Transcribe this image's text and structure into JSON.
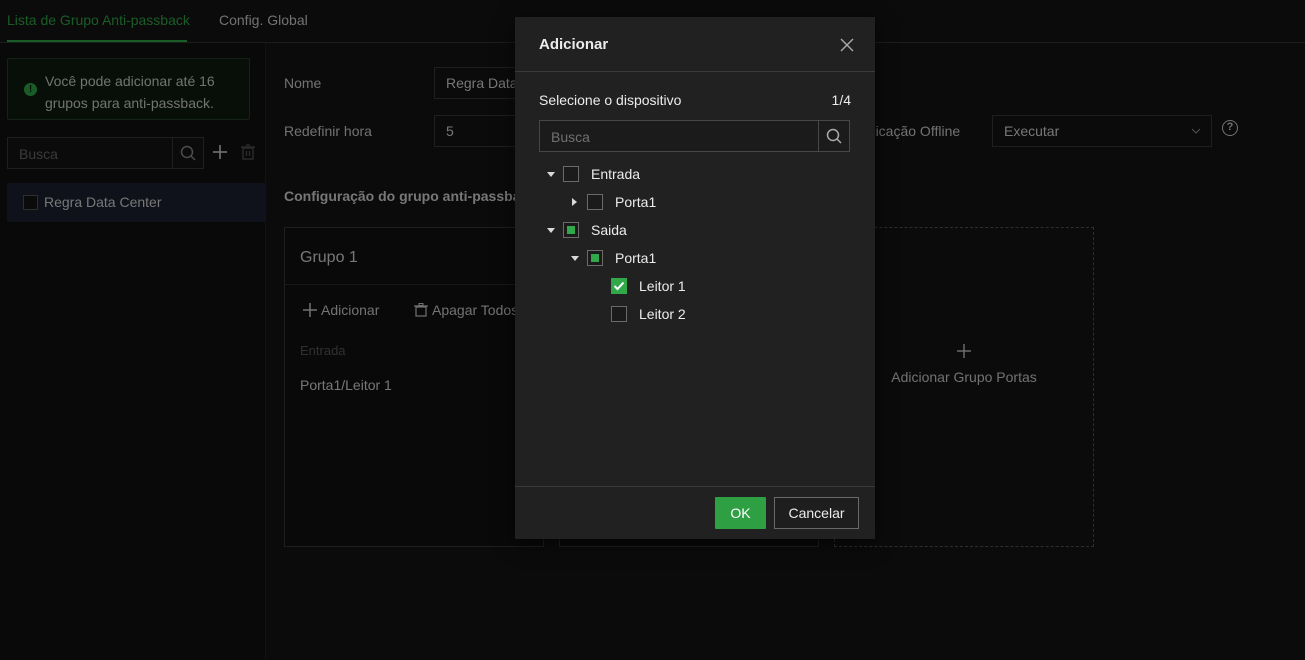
{
  "tabs": [
    {
      "label": "Lista de Grupo Anti-passback",
      "active": true
    },
    {
      "label": "Config. Global",
      "active": false
    }
  ],
  "left_panel": {
    "notice": "Você pode adicionar até 16 grupos para anti-passback.",
    "search_placeholder": "Busca",
    "rules": [
      {
        "label": "Regra Data Center",
        "checked": false
      }
    ]
  },
  "form": {
    "name_label": "Nome",
    "name_value": "Regra Data",
    "reset_label": "Redefinir hora",
    "reset_value": "5",
    "offline_label": "unicação Offline",
    "offline_value": "Executar",
    "section_title": "Configuração do grupo anti-passba"
  },
  "group": {
    "title": "Grupo 1",
    "add_label": "Adicionar",
    "delete_all_label": "Apagar Todos",
    "entrada_label": "Entrada",
    "doors": [
      "Porta1/Leitor 1"
    ]
  },
  "add_group_label": "Adicionar Grupo Portas",
  "modal": {
    "title": "Adicionar",
    "subtitle": "Selecione o dispositivo",
    "count": "1/4",
    "search_placeholder": "Busca",
    "tree": [
      {
        "label": "Entrada",
        "state": "unchecked",
        "expanded": true
      },
      {
        "label": "Porta1",
        "state": "unchecked",
        "expanded": false
      },
      {
        "label": "Saida",
        "state": "partial",
        "expanded": true
      },
      {
        "label": "Porta1",
        "state": "partial",
        "expanded": true
      },
      {
        "label": "Leitor 1",
        "state": "checked"
      },
      {
        "label": "Leitor 2",
        "state": "unchecked"
      }
    ],
    "ok_label": "OK",
    "cancel_label": "Cancelar"
  },
  "colors": {
    "accent": "#31a84a",
    "background": "#141414",
    "modal_bg": "#212121"
  }
}
